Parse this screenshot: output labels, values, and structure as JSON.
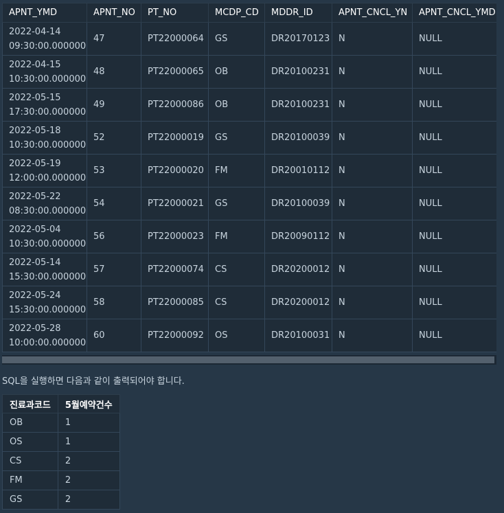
{
  "main_table": {
    "columns": [
      "APNT_YMD",
      "APNT_NO",
      "PT_NO",
      "MCDP_CD",
      "MDDR_ID",
      "APNT_CNCL_YN",
      "APNT_CNCL_YMD"
    ],
    "rows": [
      {
        "date": "2022-04-14",
        "time": "09:30:00.000000",
        "no": "47",
        "pt": "PT22000064",
        "mcdp": "GS",
        "mddr": "DR20170123",
        "yn": "N",
        "ymd": "NULL"
      },
      {
        "date": "2022-04-15",
        "time": "10:30:00.000000",
        "no": "48",
        "pt": "PT22000065",
        "mcdp": "OB",
        "mddr": "DR20100231",
        "yn": "N",
        "ymd": "NULL"
      },
      {
        "date": "2022-05-15",
        "time": "17:30:00.000000",
        "no": "49",
        "pt": "PT22000086",
        "mcdp": "OB",
        "mddr": "DR20100231",
        "yn": "N",
        "ymd": "NULL"
      },
      {
        "date": "2022-05-18",
        "time": "10:30:00.000000",
        "no": "52",
        "pt": "PT22000019",
        "mcdp": "GS",
        "mddr": "DR20100039",
        "yn": "N",
        "ymd": "NULL"
      },
      {
        "date": "2022-05-19",
        "time": "12:00:00.000000",
        "no": "53",
        "pt": "PT22000020",
        "mcdp": "FM",
        "mddr": "DR20010112",
        "yn": "N",
        "ymd": "NULL"
      },
      {
        "date": "2022-05-22",
        "time": "08:30:00.000000",
        "no": "54",
        "pt": "PT22000021",
        "mcdp": "GS",
        "mddr": "DR20100039",
        "yn": "N",
        "ymd": "NULL"
      },
      {
        "date": "2022-05-04",
        "time": "10:30:00.000000",
        "no": "56",
        "pt": "PT22000023",
        "mcdp": "FM",
        "mddr": "DR20090112",
        "yn": "N",
        "ymd": "NULL"
      },
      {
        "date": "2022-05-14",
        "time": "15:30:00.000000",
        "no": "57",
        "pt": "PT22000074",
        "mcdp": "CS",
        "mddr": "DR20200012",
        "yn": "N",
        "ymd": "NULL"
      },
      {
        "date": "2022-05-24",
        "time": "15:30:00.000000",
        "no": "58",
        "pt": "PT22000085",
        "mcdp": "CS",
        "mddr": "DR20200012",
        "yn": "N",
        "ymd": "NULL"
      },
      {
        "date": "2022-05-28",
        "time": "10:00:00.000000",
        "no": "60",
        "pt": "PT22000092",
        "mcdp": "OS",
        "mddr": "DR20100031",
        "yn": "N",
        "ymd": "NULL"
      }
    ]
  },
  "description": "SQL을 실행하면 다음과 같이 출력되어야 합니다.",
  "result_table": {
    "columns": [
      "진료과코드",
      "5월예약건수"
    ],
    "rows": [
      [
        "OB",
        "1"
      ],
      [
        "OS",
        "1"
      ],
      [
        "CS",
        "2"
      ],
      [
        "FM",
        "2"
      ],
      [
        "GS",
        "2"
      ]
    ]
  },
  "colors": {
    "background": "#263747",
    "table_bg": "#1f2c38",
    "border": "#34475a",
    "header_text": "#ffffff",
    "cell_text": "#c8d4de"
  }
}
